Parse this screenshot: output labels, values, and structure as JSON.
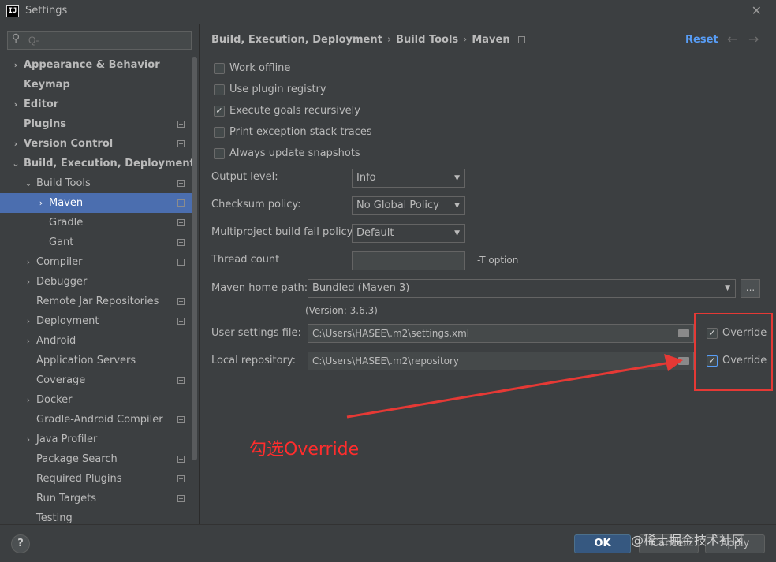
{
  "window": {
    "title": "Settings",
    "logo_text": "IJ",
    "close_icon": "close-icon"
  },
  "search": {
    "placeholder": "Q-"
  },
  "sidebar": {
    "items": [
      {
        "label": "Appearance & Behavior",
        "arrow": "›",
        "level": 0,
        "bold": true,
        "icon": false
      },
      {
        "label": "Keymap",
        "arrow": "",
        "level": 0,
        "bold": true,
        "icon": false
      },
      {
        "label": "Editor",
        "arrow": "›",
        "level": 0,
        "bold": true,
        "icon": false
      },
      {
        "label": "Plugins",
        "arrow": "",
        "level": 0,
        "bold": true,
        "icon": true
      },
      {
        "label": "Version Control",
        "arrow": "›",
        "level": 0,
        "bold": true,
        "icon": true
      },
      {
        "label": "Build, Execution, Deployment",
        "arrow": "⌄",
        "level": 0,
        "bold": true,
        "icon": false
      },
      {
        "label": "Build Tools",
        "arrow": "⌄",
        "level": 1,
        "bold": false,
        "icon": true
      },
      {
        "label": "Maven",
        "arrow": "›",
        "level": 2,
        "bold": false,
        "icon": true,
        "selected": true
      },
      {
        "label": "Gradle",
        "arrow": "",
        "level": 2,
        "bold": false,
        "icon": true
      },
      {
        "label": "Gant",
        "arrow": "",
        "level": 2,
        "bold": false,
        "icon": true
      },
      {
        "label": "Compiler",
        "arrow": "›",
        "level": 1,
        "bold": false,
        "icon": true
      },
      {
        "label": "Debugger",
        "arrow": "›",
        "level": 1,
        "bold": false,
        "icon": false
      },
      {
        "label": "Remote Jar Repositories",
        "arrow": "",
        "level": 1,
        "bold": false,
        "icon": true
      },
      {
        "label": "Deployment",
        "arrow": "›",
        "level": 1,
        "bold": false,
        "icon": true
      },
      {
        "label": "Android",
        "arrow": "›",
        "level": 1,
        "bold": false,
        "icon": false
      },
      {
        "label": "Application Servers",
        "arrow": "",
        "level": 1,
        "bold": false,
        "icon": false
      },
      {
        "label": "Coverage",
        "arrow": "",
        "level": 1,
        "bold": false,
        "icon": true
      },
      {
        "label": "Docker",
        "arrow": "›",
        "level": 1,
        "bold": false,
        "icon": false
      },
      {
        "label": "Gradle-Android Compiler",
        "arrow": "",
        "level": 1,
        "bold": false,
        "icon": true
      },
      {
        "label": "Java Profiler",
        "arrow": "›",
        "level": 1,
        "bold": false,
        "icon": false
      },
      {
        "label": "Package Search",
        "arrow": "",
        "level": 1,
        "bold": false,
        "icon": true
      },
      {
        "label": "Required Plugins",
        "arrow": "",
        "level": 1,
        "bold": false,
        "icon": true
      },
      {
        "label": "Run Targets",
        "arrow": "",
        "level": 1,
        "bold": false,
        "icon": true
      },
      {
        "label": "Testing",
        "arrow": "",
        "level": 1,
        "bold": false,
        "icon": false
      }
    ]
  },
  "breadcrumb": {
    "part1": "Build, Execution, Deployment",
    "part2": "Build Tools",
    "part3": "Maven",
    "sep": "›"
  },
  "header": {
    "reset_label": "Reset",
    "back_arrow": "←",
    "forward_arrow": "→"
  },
  "checkboxes": [
    {
      "label": "Work offline",
      "checked": false
    },
    {
      "label": "Use plugin registry",
      "checked": false
    },
    {
      "label": "Execute goals recursively",
      "checked": true
    },
    {
      "label": "Print exception stack traces",
      "checked": false
    },
    {
      "label": "Always update snapshots",
      "checked": false
    }
  ],
  "form": {
    "output_level_label": "Output level:",
    "output_level_value": "Info",
    "checksum_label": "Checksum policy:",
    "checksum_value": "No Global Policy",
    "fail_policy_label": "Multiproject build fail policy:",
    "fail_policy_value": "Default",
    "thread_count_label": "Thread count",
    "thread_count_value": "",
    "thread_hint": "-T option",
    "maven_home_label": "Maven home path:",
    "maven_home_value": "Bundled (Maven 3)",
    "maven_home_button": "...",
    "version_text": "(Version: 3.6.3)",
    "user_settings_label": "User settings file:",
    "user_settings_value": "C:\\Users\\HASEE\\.m2\\settings.xml",
    "local_repo_label": "Local repository:",
    "local_repo_value": "C:\\Users\\HASEE\\.m2\\repository",
    "override_label": "Override",
    "user_settings_override": true,
    "local_repo_override": true
  },
  "annotation": {
    "text": "勾选Override",
    "color": "#ff2d2d"
  },
  "footer": {
    "help_label": "?",
    "ok_label": "OK",
    "cancel_label": "Cancel",
    "apply_label": "Apply"
  },
  "watermark": {
    "text": "@稀土掘金技术社区"
  },
  "colors": {
    "background": "#3c3f41",
    "selection": "#4b6eaf",
    "link": "#589df6",
    "annotation_red": "#e53935"
  }
}
